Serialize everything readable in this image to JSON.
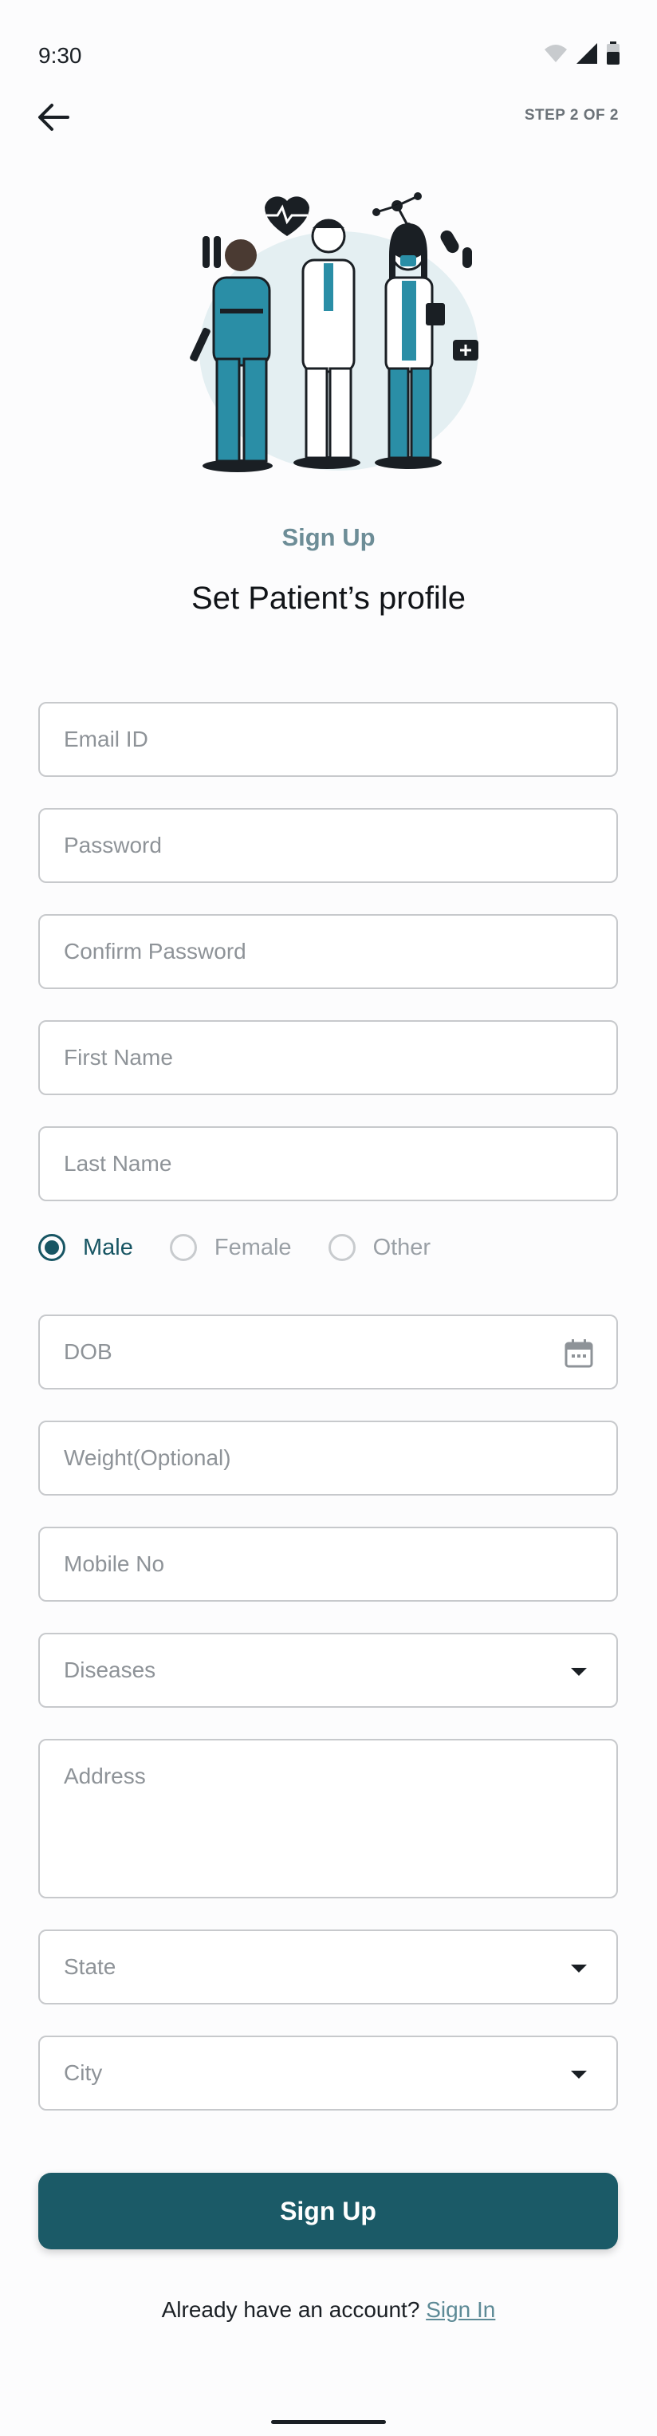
{
  "status_bar": {
    "time": "9:30"
  },
  "header": {
    "step_label": "STEP 2 OF 2"
  },
  "hero": {
    "eyebrow": "Sign Up",
    "title": "Set Patient’s profile"
  },
  "form": {
    "email": {
      "placeholder": "Email ID",
      "value": ""
    },
    "password": {
      "placeholder": "Password",
      "value": ""
    },
    "confirm_password": {
      "placeholder": "Confirm Password",
      "value": ""
    },
    "first_name": {
      "placeholder": "First Name",
      "value": ""
    },
    "last_name": {
      "placeholder": "Last Name",
      "value": ""
    },
    "gender": {
      "options": [
        "Male",
        "Female",
        "Other"
      ],
      "selected": "Male"
    },
    "dob": {
      "placeholder": "DOB",
      "value": ""
    },
    "weight": {
      "placeholder": "Weight(Optional)",
      "value": ""
    },
    "mobile": {
      "placeholder": "Mobile No",
      "value": ""
    },
    "diseases": {
      "placeholder": "Diseases"
    },
    "address": {
      "placeholder": "Address",
      "value": ""
    },
    "state": {
      "placeholder": "State"
    },
    "city": {
      "placeholder": "City"
    }
  },
  "actions": {
    "submit_label": "Sign Up"
  },
  "footer": {
    "prompt": "Already have an account?",
    "link_label": "Sign In"
  },
  "theme": {
    "primary": "#1b5a67",
    "accent_teal": "#2a8ea6",
    "eyebrow": "#6d8d97",
    "border": "#c7c9cc"
  },
  "icons": [
    "back-arrow-icon",
    "wifi-icon",
    "signal-icon",
    "battery-icon",
    "calendar-icon",
    "dropdown-caret-icon"
  ]
}
